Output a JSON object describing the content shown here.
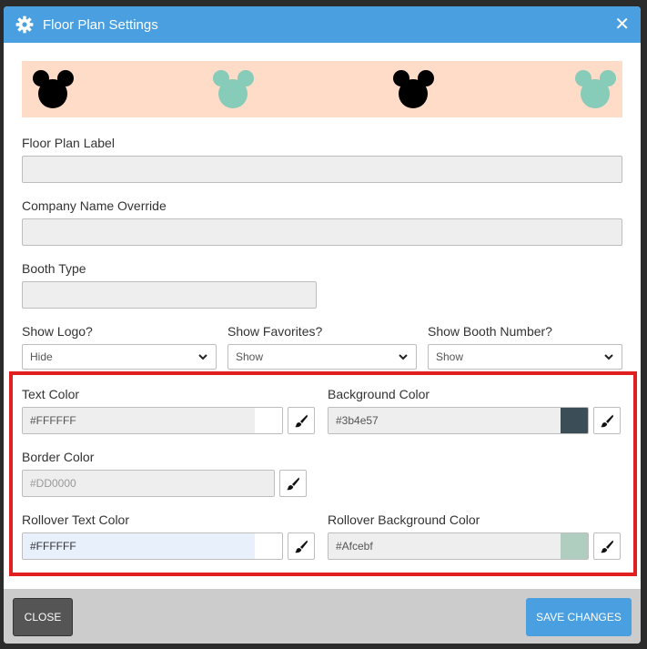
{
  "header": {
    "title": "Floor Plan Settings",
    "icon": "gear-icon",
    "close_icon": "close-icon"
  },
  "preview": {
    "background": "#ffdcc8",
    "mice_colors": [
      "#000000",
      "#87cbb9",
      "#000000",
      "#87cbb9"
    ]
  },
  "fields": {
    "floor_plan_label": {
      "label": "Floor Plan Label",
      "value": ""
    },
    "company_name_override": {
      "label": "Company Name Override",
      "value": ""
    },
    "booth_type": {
      "label": "Booth Type",
      "value": ""
    }
  },
  "selects": {
    "show_logo": {
      "label": "Show Logo?",
      "value": "Hide"
    },
    "show_favorites": {
      "label": "Show Favorites?",
      "value": "Show"
    },
    "show_booth_number": {
      "label": "Show Booth Number?",
      "value": "Show"
    }
  },
  "colors": {
    "text_color": {
      "label": "Text Color",
      "value": "#FFFFFF",
      "swatch": "#FFFFFF"
    },
    "background_color": {
      "label": "Background Color",
      "value": "#3b4e57",
      "swatch": "#3b4e57"
    },
    "border_color": {
      "label": "Border Color",
      "placeholder": "#DD0000",
      "swatch": "#eeeeee"
    },
    "rollover_text_color": {
      "label": "Rollover Text Color",
      "value": "#FFFFFF",
      "swatch": "#FFFFFF"
    },
    "rollover_background_color": {
      "label": "Rollover Background Color",
      "value": "#Afcebf",
      "swatch": "#afcebf"
    }
  },
  "footer": {
    "close_label": "CLOSE",
    "save_label": "SAVE CHANGES"
  },
  "theme": {
    "accent": "#4a9fe0",
    "highlight": "#e02020"
  }
}
